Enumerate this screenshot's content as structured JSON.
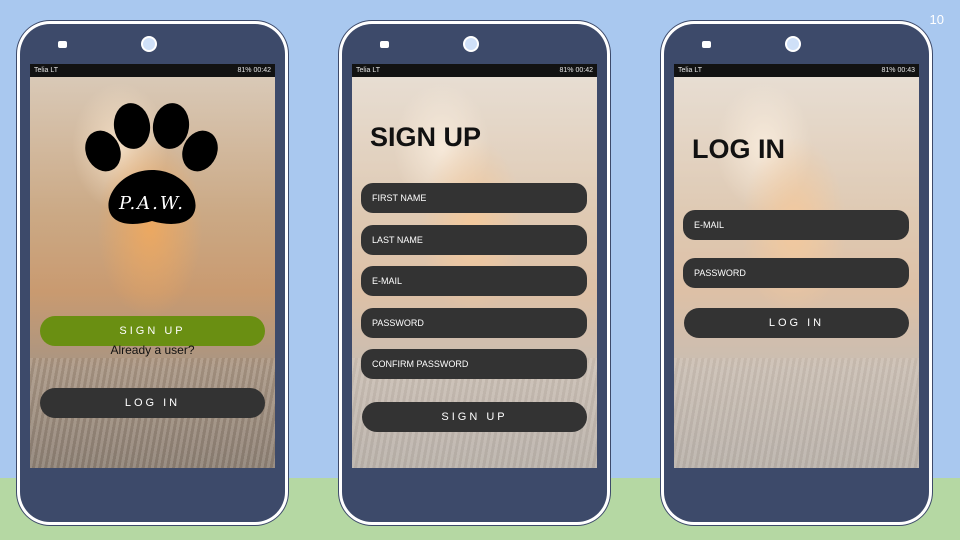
{
  "slide": {
    "page_number": "10"
  },
  "phones": [
    {
      "status": {
        "carrier": "Telia LT",
        "right": "81% 00:42"
      },
      "logo_text": "P.A.W.",
      "signup_button": "SIGN UP",
      "already_text": "Already a user?",
      "login_button": "LOG IN"
    },
    {
      "status": {
        "carrier": "Telia LT",
        "right": "81% 00:42"
      },
      "title": "SIGN UP",
      "fields": [
        "FIRST NAME",
        "LAST NAME",
        "E-MAIL",
        "PASSWORD",
        "CONFIRM PASSWORD"
      ],
      "submit_button": "SIGN UP"
    },
    {
      "status": {
        "carrier": "Telia LT",
        "right": "81% 00:43"
      },
      "title": "LOG IN",
      "fields": [
        "E-MAIL",
        "PASSWORD"
      ],
      "submit_button": "LOG IN"
    }
  ]
}
